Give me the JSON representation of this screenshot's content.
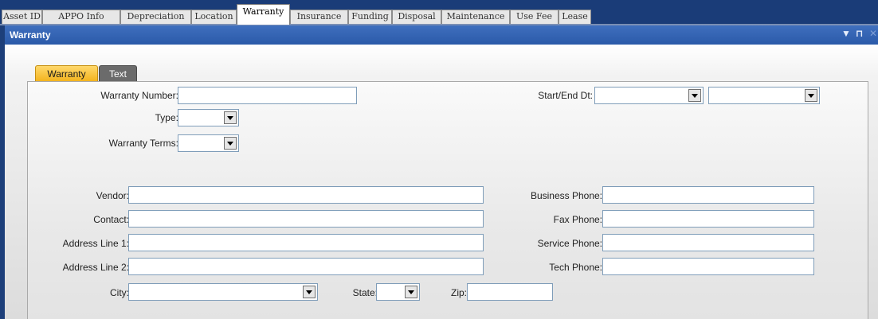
{
  "top_tabs": [
    "Asset ID",
    "APPO Info",
    "Depreciation",
    "Location",
    "Warranty",
    "Insurance",
    "Funding",
    "Disposal",
    "Maintenance",
    "Use Fee",
    "Lease"
  ],
  "active_top_tab": "Warranty",
  "panel": {
    "title": "Warranty"
  },
  "sub_tabs": {
    "warranty": "Warranty",
    "text": "Text",
    "active": "Warranty"
  },
  "form": {
    "warranty_number_label": "Warranty Number:",
    "warranty_number_value": "",
    "type_label": "Type:",
    "type_value": "",
    "warranty_terms_label": "Warranty Terms:",
    "warranty_terms_value": "",
    "start_end_label": "Start/End Dt:",
    "start_value": "",
    "end_value": "",
    "vendor_label": "Vendor:",
    "vendor_value": "",
    "contact_label": "Contact:",
    "contact_value": "",
    "address1_label": "Address Line 1:",
    "address1_value": "",
    "address2_label": "Address Line 2:",
    "address2_value": "",
    "city_label": "City:",
    "city_value": "",
    "state_label": "State:",
    "state_value": "",
    "zip_label": "Zip:",
    "zip_value": "",
    "business_phone_label": "Business Phone:",
    "business_phone_value": "",
    "fax_phone_label": "Fax Phone:",
    "fax_phone_value": "",
    "service_phone_label": "Service Phone:",
    "service_phone_value": "",
    "tech_phone_label": "Tech Phone:",
    "tech_phone_value": ""
  },
  "colors": {
    "window_bg": "#1d3f7a",
    "title_bar": "#3f6fbe",
    "active_subtab": "#f3b21b",
    "inactive_subtab": "#6b6b6b",
    "field_border": "#7f9db9"
  },
  "icons": {
    "pin": "pin-icon",
    "dropdown": "chevron-down-icon",
    "close": "close-icon"
  }
}
